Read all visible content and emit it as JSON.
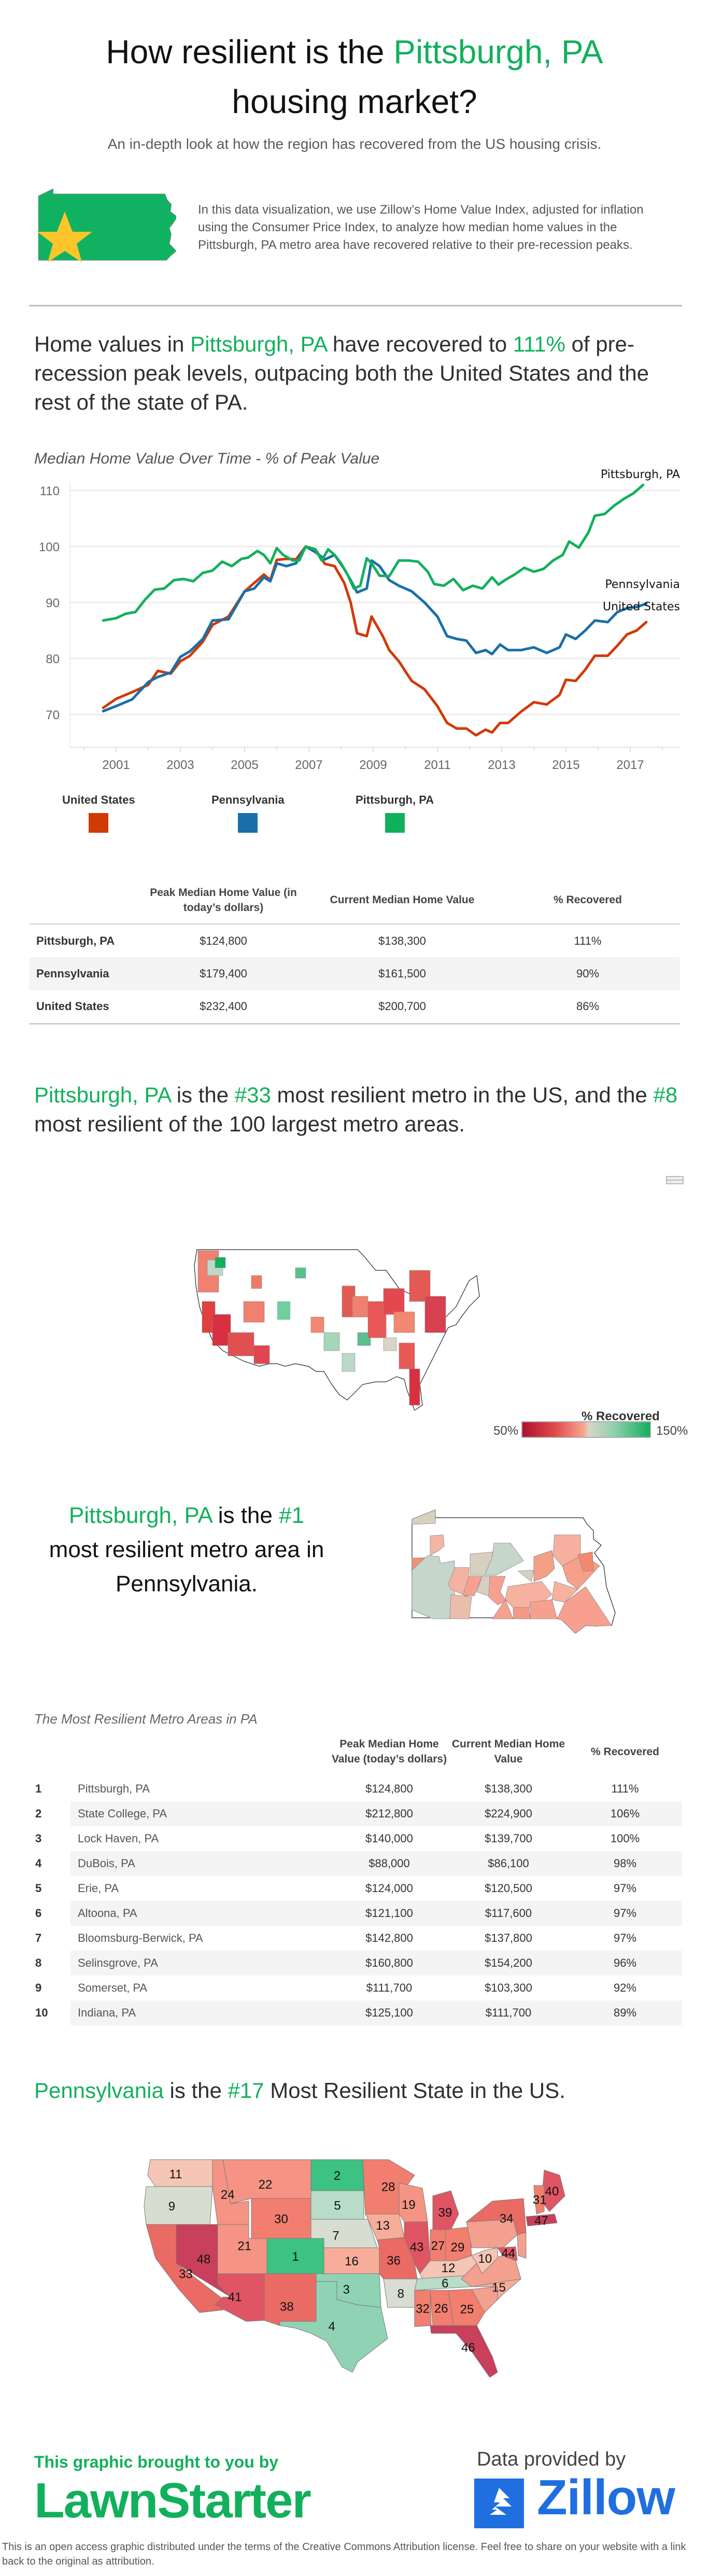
{
  "header": {
    "title_pre": "How resilient is the ",
    "title_highlight": "Pittsburgh, PA",
    "title_post": "housing market?",
    "subtitle": "An in-depth look at how the region has recovered from the US housing crisis.",
    "intro": "In this data visualization, we use Zillow’s Home Value Index, adjusted for inflation using the Consumer Price Index, to analyze how median home values in the Pittsburgh, PA metro area have recovered relative to their pre-recession peaks.",
    "icon": "pennsylvania-state-star-icon"
  },
  "headline1": {
    "pre": "Home values in ",
    "metro": "Pittsburgh, PA",
    "mid": " have recovered to ",
    "pct": "111%",
    "post": " of pre-recession peak levels, outpacing both the United States and the rest of the state of PA."
  },
  "chart_data": {
    "type": "line",
    "title": "Median Home Value Over Time - % of Peak Value",
    "xlabel": "",
    "ylabel": "",
    "xlim": [
      2000,
      2018.3
    ],
    "ylim": [
      65,
      112
    ],
    "yticks": [
      70,
      80,
      90,
      100,
      110
    ],
    "xticks": [
      2001,
      2003,
      2005,
      2007,
      2009,
      2011,
      2013,
      2015,
      2017
    ],
    "grid": true,
    "legend": "bottom",
    "series": [
      {
        "name": "United States",
        "color": "#d03a05",
        "end_label": "United States",
        "x": [
          2000.6,
          2001.0,
          2001.5,
          2002.0,
          2002.3,
          2002.7,
          2003.0,
          2003.3,
          2003.7,
          2004.0,
          2004.5,
          2005.0,
          2005.3,
          2005.6,
          2005.8,
          2006.0,
          2006.3,
          2006.6,
          2006.9,
          2007.2,
          2007.5,
          2007.8,
          2008.1,
          2008.3,
          2008.5,
          2008.8,
          2008.95,
          2009.1,
          2009.3,
          2009.5,
          2009.8,
          2010.2,
          2010.6,
          2011.0,
          2011.3,
          2011.6,
          2011.9,
          2012.2,
          2012.5,
          2012.7,
          2012.95,
          2013.2,
          2013.6,
          2014.0,
          2014.4,
          2014.8,
          2015.0,
          2015.3,
          2015.6,
          2015.9,
          2016.3,
          2016.6,
          2016.9,
          2017.2,
          2017.5
        ],
        "y": [
          71.2,
          72.8,
          74.0,
          75.3,
          77.8,
          77.3,
          79.5,
          80.5,
          83.0,
          86.0,
          87.5,
          92.0,
          93.5,
          95.0,
          94.0,
          97.6,
          97.8,
          97.7,
          100.0,
          99.5,
          96.9,
          96.5,
          93.5,
          90.0,
          84.5,
          84.0,
          87.5,
          86.0,
          84.0,
          81.5,
          79.5,
          76.0,
          74.5,
          71.5,
          68.5,
          67.5,
          67.5,
          66.3,
          67.3,
          66.8,
          68.5,
          68.5,
          70.5,
          72.2,
          71.8,
          73.5,
          76.2,
          76.0,
          78.0,
          80.5,
          80.5,
          82.3,
          84.3,
          85.0,
          86.5
        ]
      },
      {
        "name": "Pennsylvania",
        "color": "#1a6fa8",
        "end_label": "Pennsylvania",
        "x": [
          2000.6,
          2001.0,
          2001.5,
          2002.0,
          2002.3,
          2002.7,
          2003.0,
          2003.3,
          2003.7,
          2004.0,
          2004.5,
          2005.0,
          2005.3,
          2005.6,
          2005.8,
          2006.0,
          2006.3,
          2006.6,
          2006.9,
          2007.2,
          2007.5,
          2007.8,
          2008.1,
          2008.3,
          2008.5,
          2008.8,
          2008.95,
          2009.2,
          2009.5,
          2009.8,
          2010.2,
          2010.6,
          2011.0,
          2011.3,
          2011.6,
          2011.9,
          2012.2,
          2012.5,
          2012.7,
          2012.95,
          2013.2,
          2013.6,
          2014.0,
          2014.4,
          2014.8,
          2015.0,
          2015.3,
          2015.6,
          2015.9,
          2016.3,
          2016.6,
          2016.9,
          2017.2,
          2017.5
        ],
        "y": [
          70.6,
          71.5,
          72.7,
          75.8,
          76.7,
          77.5,
          80.3,
          81.3,
          83.5,
          86.8,
          87.0,
          92.0,
          92.5,
          94.5,
          93.8,
          97.0,
          96.5,
          97.0,
          100.0,
          99.0,
          97.7,
          98.5,
          96.0,
          94.0,
          91.8,
          92.5,
          97.5,
          96.5,
          94.0,
          93.0,
          92.0,
          90.0,
          87.5,
          84.0,
          83.5,
          83.2,
          81.0,
          81.5,
          80.8,
          82.5,
          81.5,
          81.5,
          82.0,
          81.0,
          82.0,
          84.3,
          83.5,
          85.0,
          86.8,
          86.5,
          88.3,
          89.0,
          89.2,
          89.8,
          90.2
        ]
      },
      {
        "name": "Pittsburgh, PA",
        "color": "#12b05c",
        "end_label": "Pittsburgh, PA",
        "x": [
          2000.6,
          2001.0,
          2001.3,
          2001.6,
          2001.9,
          2002.2,
          2002.5,
          2002.8,
          2003.1,
          2003.4,
          2003.7,
          2004.0,
          2004.3,
          2004.6,
          2004.9,
          2005.1,
          2005.4,
          2005.6,
          2005.8,
          2006.0,
          2006.2,
          2006.5,
          2006.7,
          2006.9,
          2007.2,
          2007.4,
          2007.6,
          2007.8,
          2008.0,
          2008.2,
          2008.4,
          2008.6,
          2008.8,
          2008.95,
          2009.2,
          2009.5,
          2009.8,
          2010.1,
          2010.4,
          2010.7,
          2010.9,
          2011.2,
          2011.5,
          2011.8,
          2012.1,
          2012.4,
          2012.7,
          2012.9,
          2013.1,
          2013.4,
          2013.7,
          2014.0,
          2014.3,
          2014.6,
          2014.9,
          2015.1,
          2015.4,
          2015.7,
          2015.9,
          2016.2,
          2016.5,
          2016.8,
          2017.1,
          2017.4
        ],
        "y": [
          86.8,
          87.2,
          88.0,
          88.3,
          90.5,
          92.3,
          92.5,
          94.0,
          94.2,
          93.8,
          95.3,
          95.7,
          97.3,
          96.5,
          97.8,
          98.0,
          99.2,
          98.5,
          97.0,
          99.7,
          98.5,
          97.5,
          97.5,
          100.0,
          99.5,
          97.5,
          99.5,
          98.5,
          97.0,
          95.0,
          92.5,
          93.0,
          97.9,
          97.0,
          94.8,
          94.7,
          97.5,
          97.5,
          97.3,
          95.5,
          93.3,
          93.0,
          94.2,
          92.2,
          93.0,
          92.5,
          94.5,
          93.2,
          94.0,
          95.0,
          96.2,
          95.5,
          96.0,
          97.5,
          98.5,
          100.9,
          99.8,
          102.5,
          105.5,
          105.8,
          107.3,
          108.5,
          109.5,
          111.0
        ]
      }
    ]
  },
  "summary_table": {
    "columns": [
      "",
      "Peak Median Home Value (in today’s dollars)",
      "Current Median Home Value",
      "% Recovered"
    ],
    "rows": [
      [
        "Pittsburgh, PA",
        "$124,800",
        "$138,300",
        "111%"
      ],
      [
        "Pennsylvania",
        "$179,400",
        "$161,500",
        "90%"
      ],
      [
        "United States",
        "$232,400",
        "$200,700",
        "86%"
      ]
    ]
  },
  "headline2": {
    "metro": "Pittsburgh, PA",
    "t1": " is the ",
    "rank_us": "#33",
    "t2": " most resilient metro in the US, and the ",
    "rank_top100": "#8",
    "t3": " most resilient of the 100 largest metro areas."
  },
  "us_metro_map": {
    "legend_title": "% Recovered",
    "legend_min": "50%",
    "legend_max": "150%",
    "color_low": "#b01030",
    "color_mid": "#d8d5c8",
    "color_high": "#12b05c"
  },
  "headline3": {
    "metro": "Pittsburgh, PA",
    "t1": " is the ",
    "rank": "#1",
    "t2": "most resilient metro area in Pennsylvania."
  },
  "pa_table": {
    "title": "The Most Resilient Metro Areas in PA",
    "columns": [
      "",
      "",
      "Peak Median Home Value (today’s dollars)",
      "Current Median Home Value",
      "% Recovered"
    ],
    "rows": [
      [
        "1",
        "Pittsburgh, PA",
        "$124,800",
        "$138,300",
        "111%"
      ],
      [
        "2",
        "State College, PA",
        "$212,800",
        "$224,900",
        "106%"
      ],
      [
        "3",
        "Lock Haven, PA",
        "$140,000",
        "$139,700",
        "100%"
      ],
      [
        "4",
        "DuBois, PA",
        "$88,000",
        "$86,100",
        "98%"
      ],
      [
        "5",
        "Erie, PA",
        "$124,000",
        "$120,500",
        "97%"
      ],
      [
        "6",
        "Altoona, PA",
        "$121,100",
        "$117,600",
        "97%"
      ],
      [
        "7",
        "Bloomsburg-Berwick, PA",
        "$142,800",
        "$137,800",
        "97%"
      ],
      [
        "8",
        "Selinsgrove, PA",
        "$160,800",
        "$154,200",
        "96%"
      ],
      [
        "9",
        "Somerset, PA",
        "$111,700",
        "$103,300",
        "92%"
      ],
      [
        "10",
        "Indiana, PA",
        "$125,100",
        "$111,700",
        "89%"
      ]
    ]
  },
  "headline4": {
    "state": "Pennsylvania",
    "t1": " is the ",
    "rank": "#17",
    "t2": " Most Resilient State in the US."
  },
  "state_ranks": {
    "WA": "11",
    "OR": "9",
    "CA": "33",
    "NV": "48",
    "ID": "24",
    "MT": "22",
    "WY": "30",
    "UT": "21",
    "AZ": "41",
    "CO": "1",
    "NM": "38",
    "ND": "2",
    "SD": "5",
    "NE": "7",
    "KS": "16",
    "OK": "3",
    "TX": "4",
    "MN": "28",
    "IA": "13",
    "MO": "36",
    "AR": "8",
    "WI": "19",
    "IL": "43",
    "MI": "39",
    "IN": "27",
    "OH": "29",
    "KY": "12",
    "TN": "6",
    "MS": "32",
    "AL": "26",
    "GA": "25",
    "FL": "46",
    "WV": "10",
    "NC": "15",
    "NY": "34",
    "ME": "40",
    "NH": "31",
    "MA": "47",
    "MD": "44"
  },
  "footer": {
    "brought_by": "This graphic brought to you by",
    "brand": "LawnStarter",
    "data_by": "Data provided by",
    "data_brand": "Zillow",
    "license": "This is an open access graphic distributed under the terms of the Creative Commons Attribution license.  Feel free to share on your website with a link back to the original as attribution."
  }
}
